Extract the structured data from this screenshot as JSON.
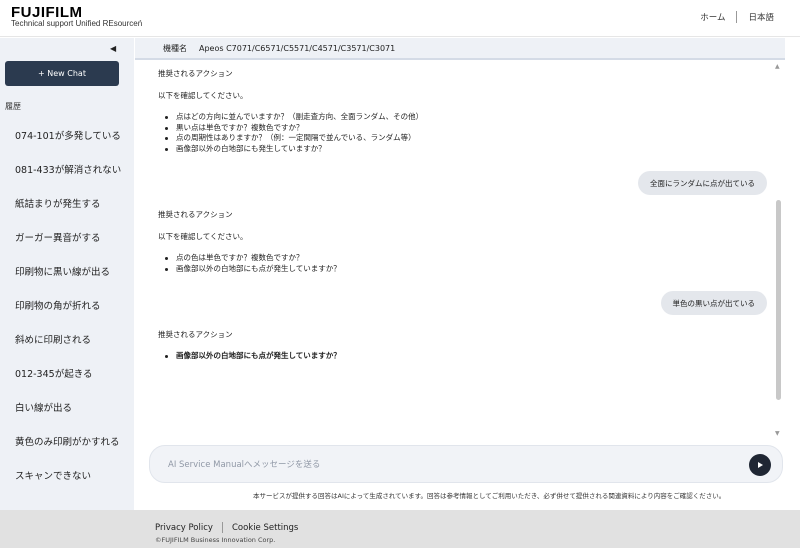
{
  "header": {
    "logo_text": "FUJIFILM",
    "logo_subtitle": "Technical support Unified REsourceń",
    "nav": [
      "ホーム",
      "日本語"
    ]
  },
  "sidebar": {
    "collapse_icon": "triangle-left-icon",
    "new_chat_label": "+ New Chat",
    "history_label": "履歴",
    "history": [
      "074-101が多発している",
      "081-433が解消されない",
      "紙詰まりが発生する",
      "ガーガー異音がする",
      "印刷物に黒い線が出る",
      "印刷物の角が折れる",
      "斜めに印刷される",
      "012-345が起きる",
      "白い線が出る",
      "黄色のみ印刷がかすれる",
      "スキャンできない"
    ]
  },
  "model_bar": {
    "label": "機種名",
    "value": "Apeos C7071/C6571/C5571/C4571/C3571/C3071"
  },
  "chat": {
    "messages": [
      {
        "role": "bot",
        "title": "推奨されるアクション",
        "lead": "以下を確認してください。",
        "items": [
          "点はどの方向に並んでいますか？（副走査方向、全面ランダム、その他）",
          "黒い点は単色ですか？複数色ですか？",
          "点の周期性はありますか？（例：一定間隔で並んでいる、ランダム等）",
          "画像部以外の白地部にも発生していますか？"
        ]
      },
      {
        "role": "user",
        "text": "全面にランダムに点が出ている"
      },
      {
        "role": "bot",
        "title": "推奨されるアクション",
        "lead": "以下を確認してください。",
        "items": [
          "点の色は単色ですか？複数色ですか？",
          "画像部以外の白地部にも点が発生していますか？"
        ]
      },
      {
        "role": "user",
        "text": "単色の黒い点が出ている"
      },
      {
        "role": "bot",
        "title": "推奨されるアクション",
        "items": [
          "画像部以外の白地部にも点が発生していますか？"
        ]
      }
    ]
  },
  "input": {
    "placeholder": "AI Service Manualへメッセージを送る",
    "send_icon": "send-play-icon"
  },
  "disclaimer": "本サービスが提供する回答はAIによって生成されています。回答は参考情報としてご利用いただき、必ず併せて提供される関連資料により内容をご確認ください。",
  "footer": {
    "links": [
      "Privacy Policy",
      "Cookie Settings"
    ],
    "copyright": "©FUJIFILM Business Innovation Corp."
  },
  "colors": {
    "sidebar_bg": "#eef1f6",
    "new_chat_button": "#2b3a4f",
    "send_button": "#1f2633",
    "user_bubble": "#e4e7ec",
    "footer_bg": "#e1e1e1"
  }
}
